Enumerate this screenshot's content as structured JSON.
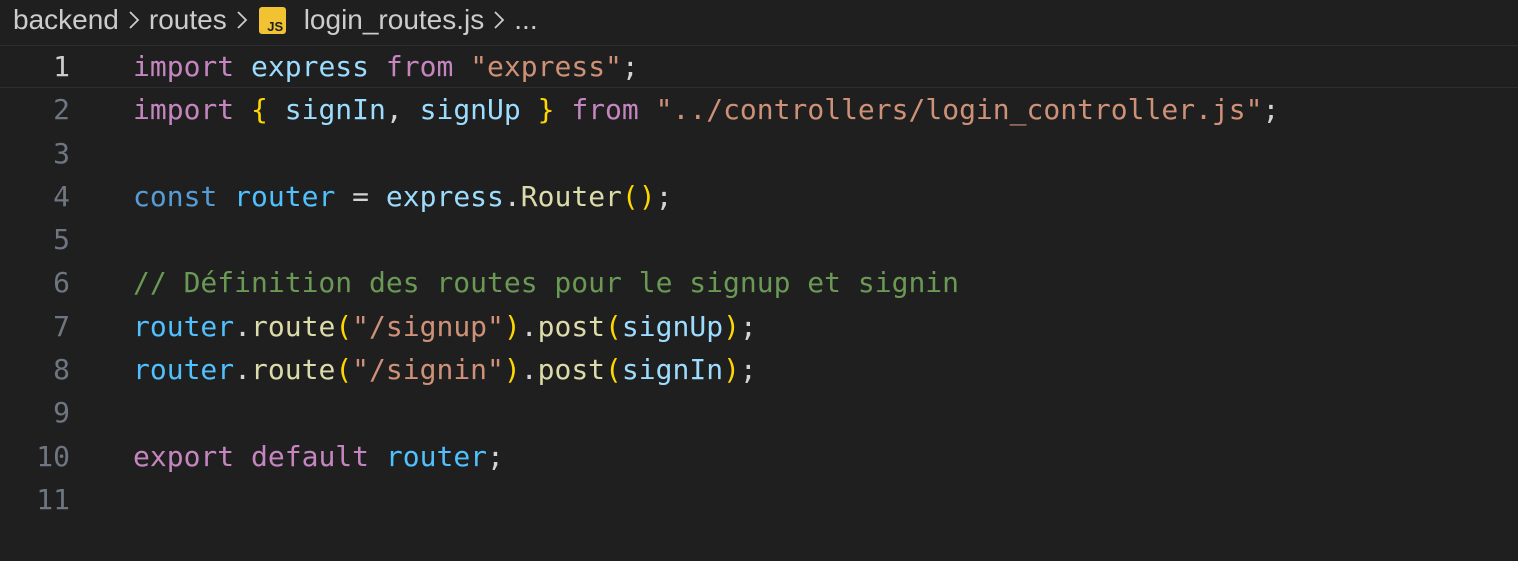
{
  "breadcrumb": {
    "folder1": "backend",
    "folder2": "routes",
    "file_badge": "JS",
    "file": "login_routes.js",
    "more": "..."
  },
  "editor": {
    "active_line": 1,
    "lines": [
      {
        "number": "1",
        "tokens": [
          {
            "cls": "kw",
            "text": "import"
          },
          {
            "cls": "pun",
            "text": " "
          },
          {
            "cls": "var",
            "text": "express"
          },
          {
            "cls": "pun",
            "text": " "
          },
          {
            "cls": "kw",
            "text": "from"
          },
          {
            "cls": "pun",
            "text": " "
          },
          {
            "cls": "str",
            "text": "\"express\""
          },
          {
            "cls": "pun",
            "text": ";"
          }
        ]
      },
      {
        "number": "2",
        "tokens": [
          {
            "cls": "kw",
            "text": "import"
          },
          {
            "cls": "pun",
            "text": " "
          },
          {
            "cls": "br1",
            "text": "{"
          },
          {
            "cls": "pun",
            "text": " "
          },
          {
            "cls": "var",
            "text": "signIn"
          },
          {
            "cls": "pun",
            "text": ", "
          },
          {
            "cls": "var",
            "text": "signUp"
          },
          {
            "cls": "pun",
            "text": " "
          },
          {
            "cls": "br1",
            "text": "}"
          },
          {
            "cls": "pun",
            "text": " "
          },
          {
            "cls": "kw",
            "text": "from"
          },
          {
            "cls": "pun",
            "text": " "
          },
          {
            "cls": "str",
            "text": "\"../controllers/login_controller.js\""
          },
          {
            "cls": "pun",
            "text": ";"
          }
        ]
      },
      {
        "number": "3",
        "tokens": []
      },
      {
        "number": "4",
        "tokens": [
          {
            "cls": "st",
            "text": "const"
          },
          {
            "cls": "pun",
            "text": " "
          },
          {
            "cls": "cst",
            "text": "router"
          },
          {
            "cls": "pun",
            "text": " = "
          },
          {
            "cls": "var",
            "text": "express"
          },
          {
            "cls": "pun",
            "text": "."
          },
          {
            "cls": "fn",
            "text": "Router"
          },
          {
            "cls": "br1",
            "text": "()"
          },
          {
            "cls": "pun",
            "text": ";"
          }
        ]
      },
      {
        "number": "5",
        "tokens": []
      },
      {
        "number": "6",
        "tokens": [
          {
            "cls": "cm",
            "text": "// Définition des routes pour le signup et signin"
          }
        ]
      },
      {
        "number": "7",
        "tokens": [
          {
            "cls": "cst",
            "text": "router"
          },
          {
            "cls": "pun",
            "text": "."
          },
          {
            "cls": "fn",
            "text": "route"
          },
          {
            "cls": "br1",
            "text": "("
          },
          {
            "cls": "str",
            "text": "\"/signup\""
          },
          {
            "cls": "br1",
            "text": ")"
          },
          {
            "cls": "pun",
            "text": "."
          },
          {
            "cls": "fn",
            "text": "post"
          },
          {
            "cls": "br1",
            "text": "("
          },
          {
            "cls": "var",
            "text": "signUp"
          },
          {
            "cls": "br1",
            "text": ")"
          },
          {
            "cls": "pun",
            "text": ";"
          }
        ]
      },
      {
        "number": "8",
        "tokens": [
          {
            "cls": "cst",
            "text": "router"
          },
          {
            "cls": "pun",
            "text": "."
          },
          {
            "cls": "fn",
            "text": "route"
          },
          {
            "cls": "br1",
            "text": "("
          },
          {
            "cls": "str",
            "text": "\"/signin\""
          },
          {
            "cls": "br1",
            "text": ")"
          },
          {
            "cls": "pun",
            "text": "."
          },
          {
            "cls": "fn",
            "text": "post"
          },
          {
            "cls": "br1",
            "text": "("
          },
          {
            "cls": "var",
            "text": "signIn"
          },
          {
            "cls": "br1",
            "text": ")"
          },
          {
            "cls": "pun",
            "text": ";"
          }
        ]
      },
      {
        "number": "9",
        "tokens": []
      },
      {
        "number": "10",
        "tokens": [
          {
            "cls": "kw",
            "text": "export"
          },
          {
            "cls": "pun",
            "text": " "
          },
          {
            "cls": "kw",
            "text": "default"
          },
          {
            "cls": "pun",
            "text": " "
          },
          {
            "cls": "cst",
            "text": "router"
          },
          {
            "cls": "pun",
            "text": ";"
          }
        ]
      },
      {
        "number": "11",
        "tokens": []
      }
    ]
  },
  "colors": {
    "background": "#1f1f1f",
    "keyword": "#c586c0",
    "storage": "#569cd6",
    "variable": "#9cdcfe",
    "constant": "#4fc1ff",
    "string": "#ce9178",
    "function": "#dcdcaa",
    "bracket": "#ffd700",
    "comment": "#6a9955",
    "js_badge": "#f1c232"
  }
}
